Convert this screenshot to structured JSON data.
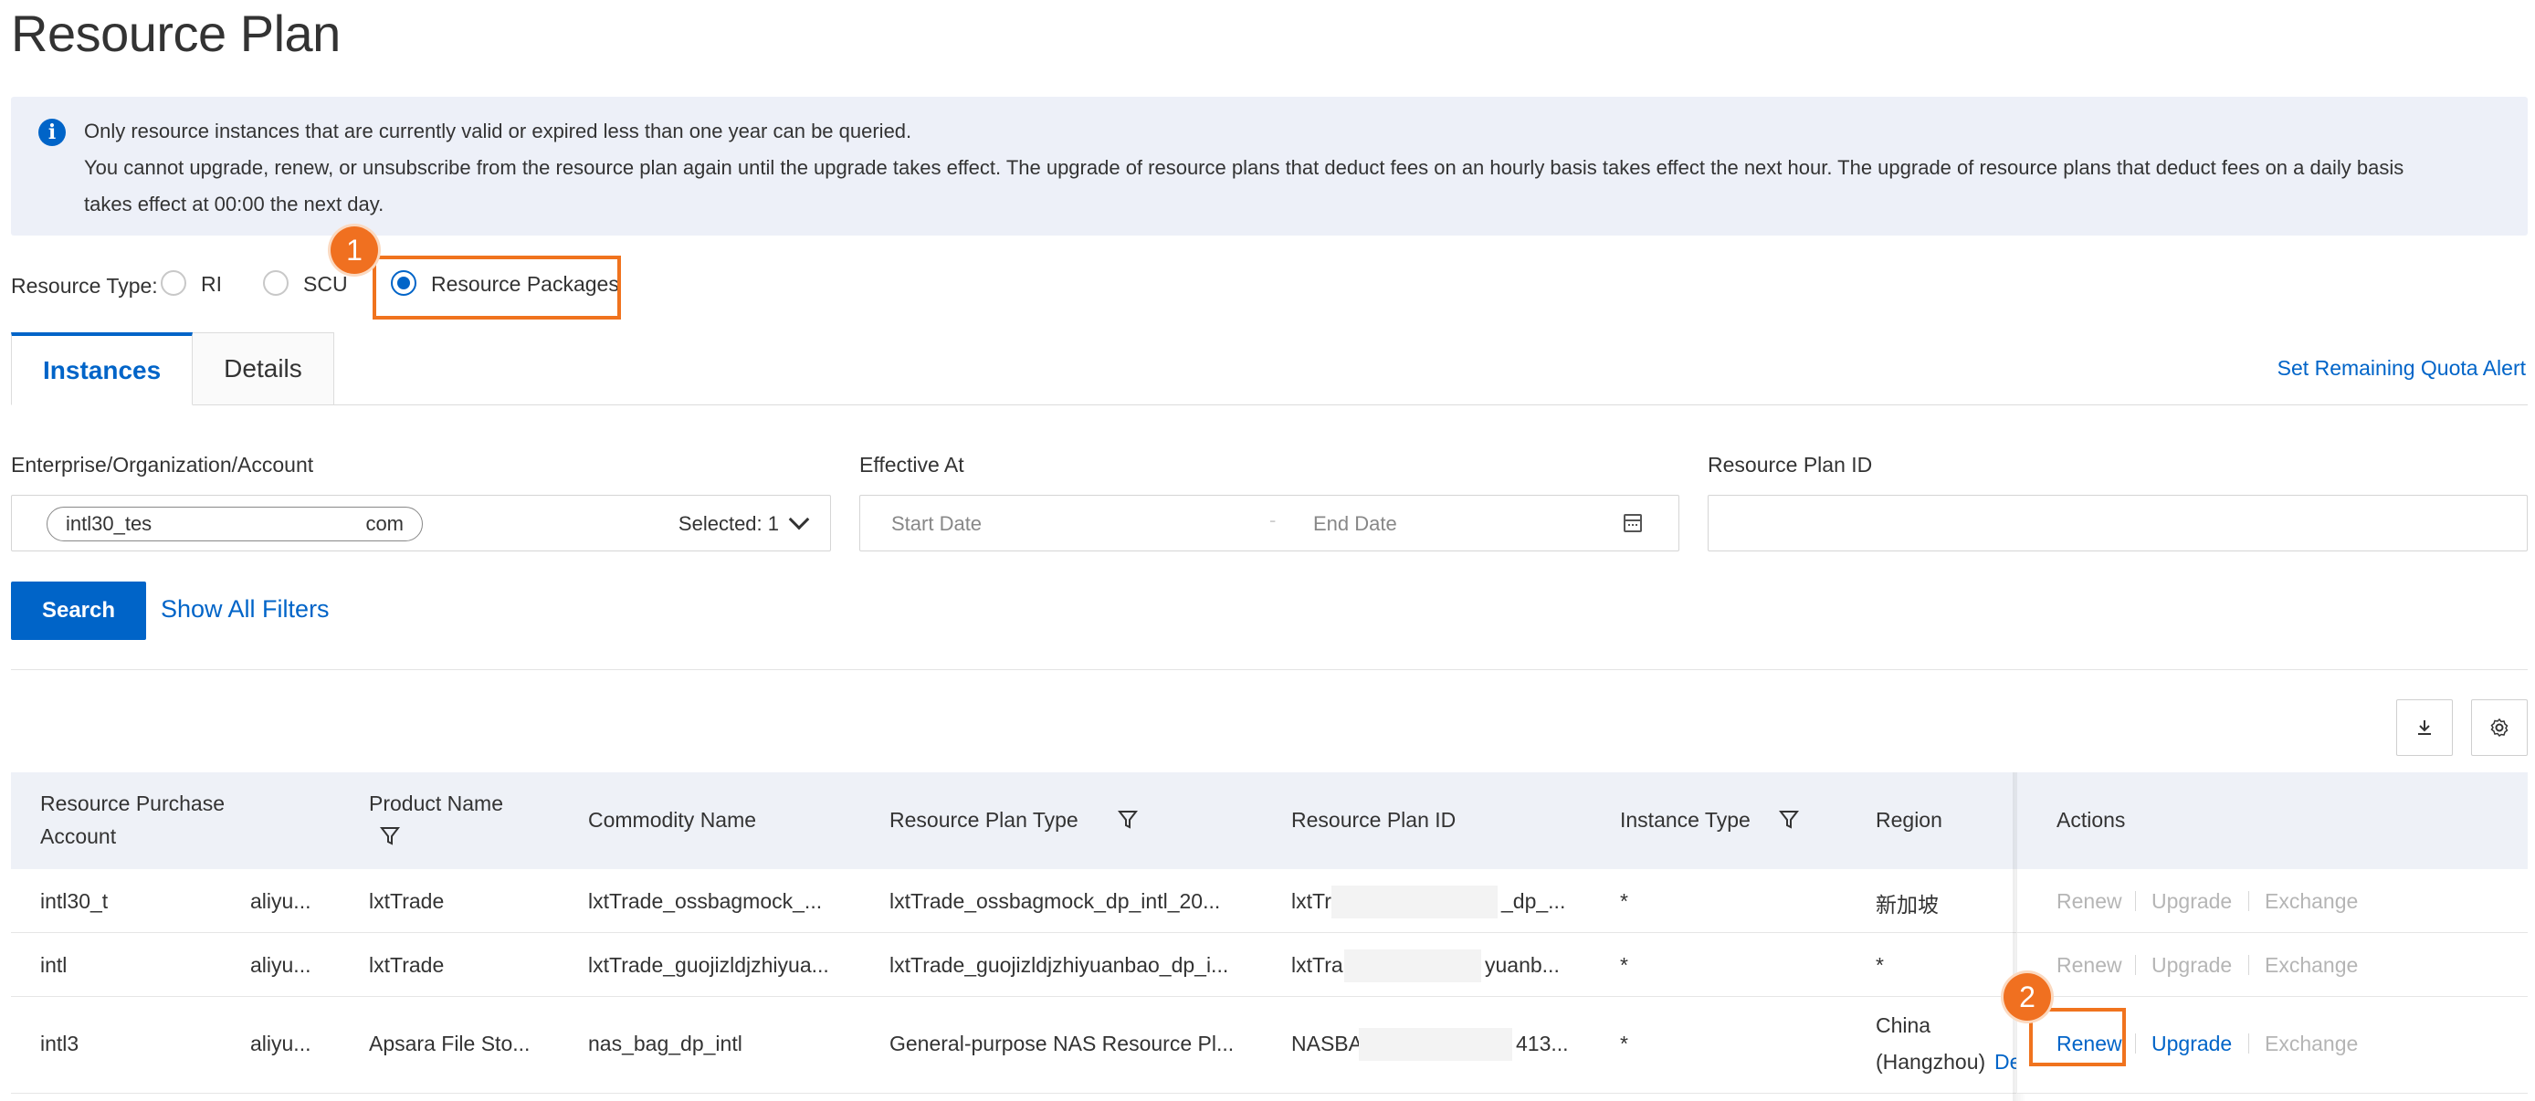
{
  "page": {
    "title": "Resource Plan"
  },
  "notice": {
    "line1": "Only resource instances that are currently valid or expired less than one year can be queried.",
    "line2": "You cannot upgrade, renew, or unsubscribe from the resource plan again until the upgrade takes effect. The upgrade of resource plans that deduct fees on an hourly basis takes effect the next hour. The upgrade of resource plans that deduct fees on a daily basis",
    "line3": "takes effect at 00:00 the next day."
  },
  "resource_type": {
    "label": "Resource Type:",
    "options": [
      "RI",
      "SCU",
      "Resource Packages"
    ],
    "selected": "Resource Packages"
  },
  "annotations": {
    "step1": "1",
    "step2": "2"
  },
  "tabs": [
    {
      "label": "Instances",
      "active": true
    },
    {
      "label": "Details",
      "active": false
    }
  ],
  "quota_alert_link": "Set Remaining Quota Alert",
  "filters": {
    "account": {
      "label": "Enterprise/Organization/Account",
      "chip_start": "intl30_tes",
      "chip_end": "com",
      "selected": "Selected: 1"
    },
    "effective_at": {
      "label": "Effective At",
      "start_placeholder": "Start Date",
      "separator": "-",
      "end_placeholder": "End Date"
    },
    "plan_id": {
      "label": "Resource Plan ID",
      "value": ""
    }
  },
  "buttons": {
    "search": "Search",
    "show_all_filters": "Show All Filters"
  },
  "table": {
    "headers": {
      "account_l1": "Resource Purchase",
      "account_l2": "Account",
      "product": "Product Name",
      "commodity": "Commodity Name",
      "plan_type": "Resource Plan Type",
      "plan_id": "Resource Plan ID",
      "instance_type": "Instance Type",
      "region": "Region",
      "actions": "Actions"
    },
    "rows": [
      {
        "account": "intl30_t",
        "account2": "aliyu...",
        "product": "lxtTrade",
        "commodity": "lxtTrade_ossbagmock_...",
        "plan_type": "lxtTrade_ossbagmock_dp_intl_20...",
        "plan_id_start": "lxtTr",
        "plan_id_end": "_dp_...",
        "instance_type": "*",
        "region": "新加坡",
        "region2": ""
      },
      {
        "account": "intl",
        "account2": "aliyu...",
        "product": "lxtTrade",
        "commodity": "lxtTrade_guojizldjzhiyua...",
        "plan_type": "lxtTrade_guojizldjzhiyuanbao_dp_i...",
        "plan_id_start": "lxtTra",
        "plan_id_end": "yuanb...",
        "instance_type": "*",
        "region": "*",
        "region2": ""
      },
      {
        "account": "intl3",
        "account2": "aliyu...",
        "product": "Apsara File Sto...",
        "commodity": "nas_bag_dp_intl",
        "plan_type": "General-purpose NAS Resource Pl...",
        "plan_id_start": "NASBA",
        "plan_id_end": "413...",
        "instance_type": "*",
        "region": "China",
        "region2": "(Hangzhou)",
        "region_link": "De"
      }
    ],
    "actions": {
      "renew": "Renew",
      "upgrade": "Upgrade",
      "exchange": "Exchange"
    }
  }
}
